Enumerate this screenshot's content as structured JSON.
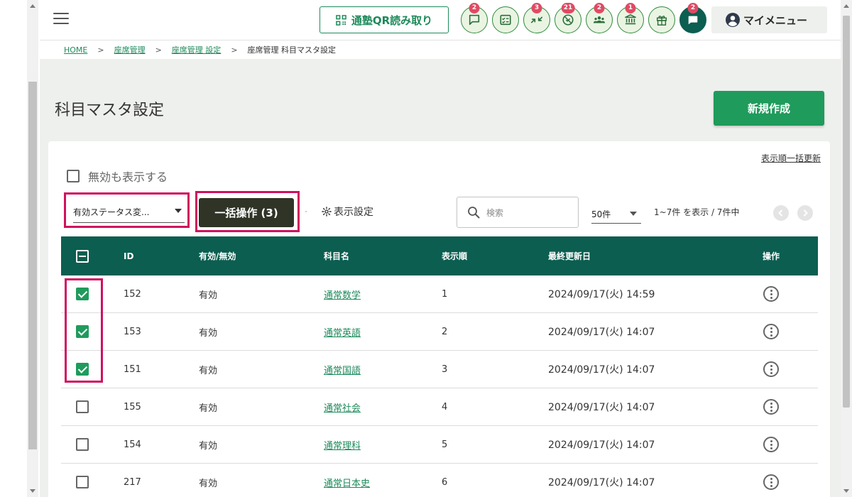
{
  "topbar": {
    "qr_label": "通塾QR読み取り",
    "badges": [
      "2",
      "3",
      "21",
      "2",
      "1",
      "2"
    ],
    "mymenu_label": "マイメニュー"
  },
  "breadcrumb": [
    "HOME",
    "座席管理",
    "座席管理 設定",
    "座席管理 科目マスタ設定"
  ],
  "page": {
    "title": "科目マスタ設定",
    "new_button": "新規作成",
    "bulk_update_link": "表示順一括更新",
    "show_invalid_label": "無効も表示する",
    "status_select_value": "有効ステータス変...",
    "bulk_action_label": "一括操作 (3)",
    "display_settings_label": "表示設定",
    "search_placeholder": "検索",
    "per_page_value": "50件",
    "range_text": "1~7件 を表示 / 7件中"
  },
  "table": {
    "headers": {
      "id": "ID",
      "status": "有効/無効",
      "name": "科目名",
      "order": "表示順",
      "updated": "最終更新日",
      "ops": "操作"
    },
    "rows": [
      {
        "checked": true,
        "id": "152",
        "status": "有効",
        "name": "通常数学",
        "order": "1",
        "updated": "2024/09/17(火) 14:59"
      },
      {
        "checked": true,
        "id": "153",
        "status": "有効",
        "name": "通常英語",
        "order": "2",
        "updated": "2024/09/17(火) 14:07"
      },
      {
        "checked": true,
        "id": "151",
        "status": "有効",
        "name": "通常国語",
        "order": "3",
        "updated": "2024/09/17(火) 14:07"
      },
      {
        "checked": false,
        "id": "155",
        "status": "有効",
        "name": "通常社会",
        "order": "4",
        "updated": "2024/09/17(火) 14:07"
      },
      {
        "checked": false,
        "id": "154",
        "status": "有効",
        "name": "通常理科",
        "order": "5",
        "updated": "2024/09/17(火) 14:07"
      },
      {
        "checked": false,
        "id": "217",
        "status": "有効",
        "name": "通常日本史",
        "order": "6",
        "updated": "2024/09/17(火) 14:07"
      }
    ]
  },
  "colors": {
    "primary": "#1f9b5c",
    "header_bg": "#0b5e50",
    "highlight": "#d0115e",
    "badge": "#e04a64"
  }
}
